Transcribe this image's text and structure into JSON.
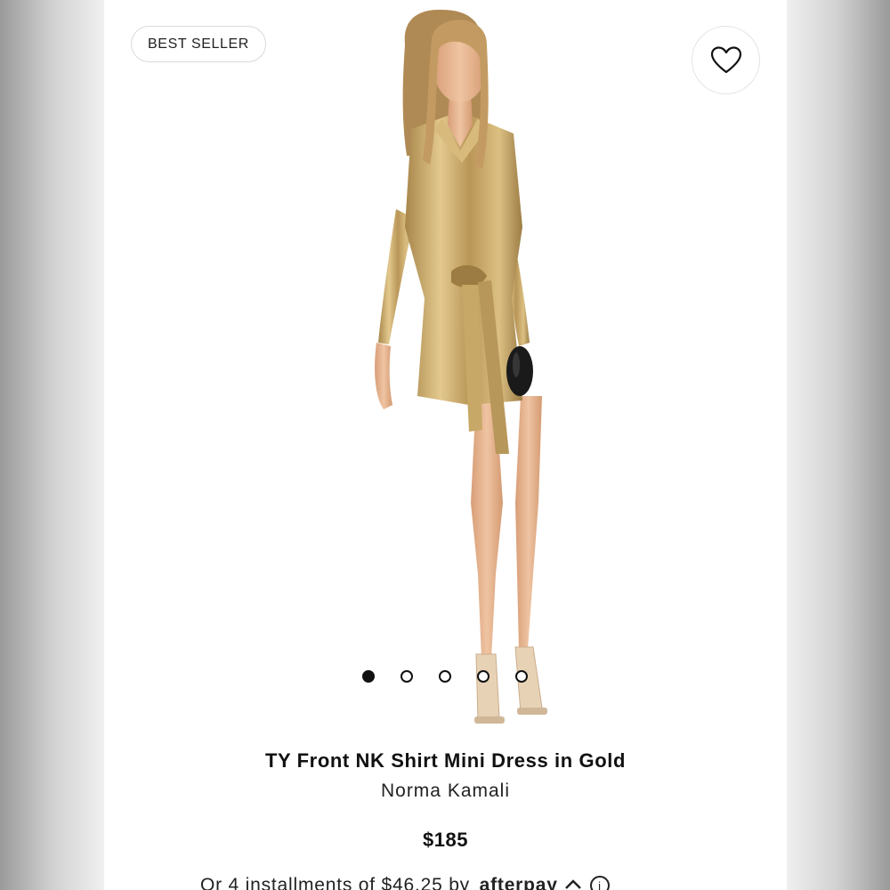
{
  "badge": {
    "label": "BEST SELLER"
  },
  "favorite": {
    "icon": "heart-outline-icon"
  },
  "gallery": {
    "image_alt": "Model wearing gold metallic shirt mini dress with tie front, holding black clutch",
    "slide_count": 5,
    "active_index": 0
  },
  "product": {
    "title": "TY Front NK Shirt Mini Dress in Gold",
    "brand": "Norma Kamali",
    "price": "$185"
  },
  "installments": {
    "text": "Or 4 installments of $46.25 by",
    "provider": "afterpay",
    "provider_icon": "afterpay-loop-icon",
    "info_icon": "info-icon"
  },
  "colors": {
    "accent": "#111111",
    "dress_gold": "#c9a75c",
    "border": "#d9d9d9"
  }
}
